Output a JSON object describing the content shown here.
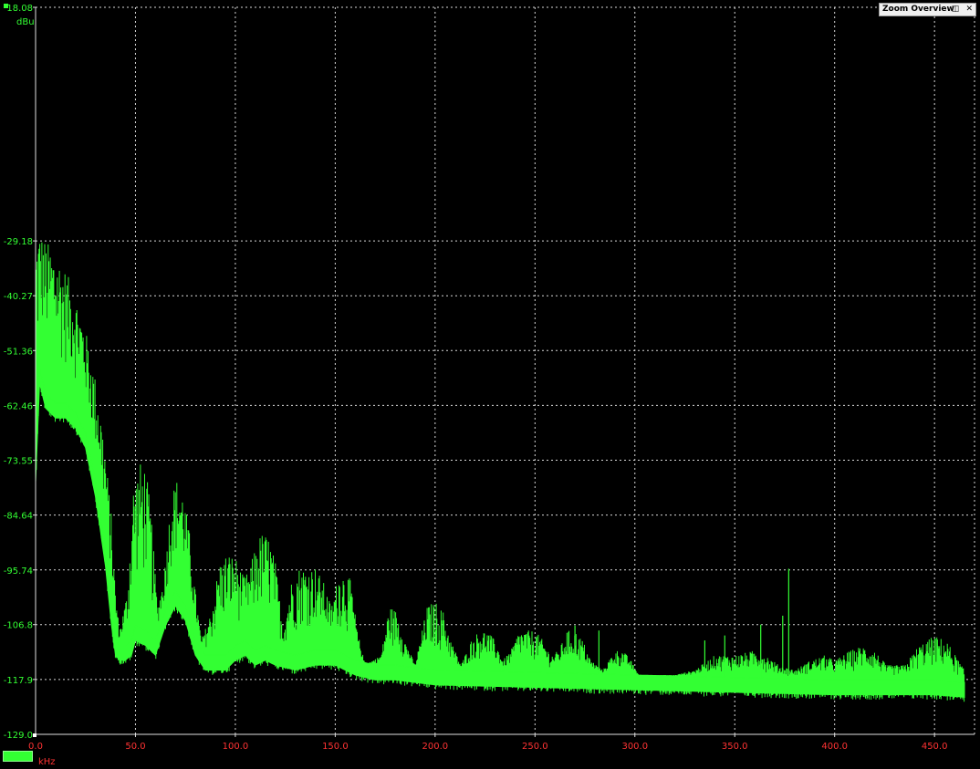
{
  "window": {
    "zoom_overview_label": "Zoom Overview",
    "zoom_overview_buttons": [
      "restore-icon",
      "close-icon"
    ]
  },
  "colors": {
    "trace": "#33ff33",
    "y_labels": "#33ff33",
    "x_labels": "#ff3333",
    "grid": "#d8d8d8",
    "background": "#000000"
  },
  "chart_data": {
    "type": "line",
    "title": "",
    "xlabel": "kHz",
    "ylabel": "dBu",
    "xlim": [
      0,
      465
    ],
    "ylim": [
      -129.0,
      18.08
    ],
    "grid": true,
    "y_tick_values": [
      18.08,
      -29.18,
      -40.27,
      -51.36,
      -62.46,
      -73.55,
      -84.64,
      -95.74,
      -106.8,
      -117.9,
      -129.0
    ],
    "y_tick_labels": [
      "18.08",
      "-29.18",
      "-40.27",
      "-51.36",
      "-62.46",
      "-73.55",
      "-84.64",
      "-95.74",
      "-106.8",
      "-117.9",
      "-129.0"
    ],
    "x_tick_values": [
      0,
      50,
      100,
      150,
      200,
      250,
      300,
      350,
      400,
      450
    ],
    "x_tick_labels": [
      "0.0",
      "50.0",
      "100.0",
      "150.0",
      "200.0",
      "250.0",
      "300.0",
      "350.0",
      "400.0",
      "450.0"
    ],
    "series": [
      {
        "color": "#33ff33",
        "noise_floor": [
          [
            0,
            -75
          ],
          [
            2,
            -55
          ],
          [
            5,
            -60
          ],
          [
            10,
            -62
          ],
          [
            15,
            -62
          ],
          [
            20,
            -64
          ],
          [
            25,
            -68
          ],
          [
            30,
            -78
          ],
          [
            35,
            -92
          ],
          [
            38,
            -104
          ],
          [
            40,
            -110
          ],
          [
            42,
            -111
          ],
          [
            45,
            -111
          ],
          [
            48,
            -110
          ],
          [
            50,
            -107
          ],
          [
            55,
            -108
          ],
          [
            60,
            -110
          ],
          [
            65,
            -104
          ],
          [
            70,
            -100
          ],
          [
            75,
            -103
          ],
          [
            80,
            -110
          ],
          [
            85,
            -113
          ],
          [
            90,
            -113
          ],
          [
            95,
            -113
          ],
          [
            100,
            -111
          ],
          [
            105,
            -110
          ],
          [
            110,
            -112
          ],
          [
            115,
            -111
          ],
          [
            120,
            -112
          ],
          [
            130,
            -113
          ],
          [
            140,
            -112
          ],
          [
            150,
            -112
          ],
          [
            160,
            -114
          ],
          [
            170,
            -115
          ],
          [
            180,
            -115
          ],
          [
            200,
            -116
          ],
          [
            250,
            -116.5
          ],
          [
            300,
            -117
          ],
          [
            350,
            -117.5
          ],
          [
            400,
            -118
          ],
          [
            450,
            -118
          ],
          [
            465,
            -118.5
          ]
        ],
        "envelope": [
          [
            0,
            -27
          ],
          [
            2,
            -27
          ],
          [
            5,
            -29
          ],
          [
            10,
            -31
          ],
          [
            15,
            -35
          ],
          [
            20,
            -40
          ],
          [
            25,
            -47
          ],
          [
            30,
            -57
          ],
          [
            33,
            -65
          ],
          [
            35,
            -72
          ],
          [
            38,
            -85
          ],
          [
            40,
            -100
          ],
          [
            42,
            -108
          ],
          [
            46,
            -100
          ],
          [
            49,
            -78
          ],
          [
            52,
            -74
          ],
          [
            55,
            -74
          ],
          [
            58,
            -85
          ],
          [
            61,
            -103
          ],
          [
            64,
            -98
          ],
          [
            68,
            -80
          ],
          [
            71,
            -77
          ],
          [
            74,
            -80
          ],
          [
            77,
            -88
          ],
          [
            80,
            -100
          ],
          [
            83,
            -110
          ],
          [
            88,
            -104
          ],
          [
            92,
            -94
          ],
          [
            96,
            -92
          ],
          [
            100,
            -93
          ],
          [
            104,
            -97
          ],
          [
            107,
            -96
          ],
          [
            111,
            -89
          ],
          [
            114,
            -88
          ],
          [
            117,
            -89
          ],
          [
            120,
            -94
          ],
          [
            124,
            -108
          ],
          [
            128,
            -98
          ],
          [
            132,
            -95
          ],
          [
            136,
            -95
          ],
          [
            140,
            -95
          ],
          [
            144,
            -98
          ],
          [
            148,
            -103
          ],
          [
            152,
            -96
          ],
          [
            155,
            -96
          ],
          [
            158,
            -98
          ],
          [
            161,
            -108
          ],
          [
            165,
            -115
          ],
          [
            173,
            -113
          ],
          [
            177,
            -103
          ],
          [
            181,
            -104
          ],
          [
            185,
            -110
          ],
          [
            190,
            -115
          ],
          [
            196,
            -103
          ],
          [
            200,
            -102
          ],
          [
            204,
            -104
          ],
          [
            208,
            -110
          ],
          [
            213,
            -115
          ],
          [
            218,
            -110
          ],
          [
            222,
            -108
          ],
          [
            226,
            -108
          ],
          [
            230,
            -110
          ],
          [
            234,
            -114
          ],
          [
            238,
            -112
          ],
          [
            242,
            -108
          ],
          [
            246,
            -108
          ],
          [
            250,
            -108
          ],
          [
            254,
            -110
          ],
          [
            258,
            -113
          ],
          [
            262,
            -112
          ],
          [
            266,
            -108
          ],
          [
            270,
            -108
          ],
          [
            274,
            -110
          ],
          [
            278,
            -114
          ],
          [
            284,
            -116
          ],
          [
            290,
            -112
          ],
          [
            294,
            -112
          ],
          [
            298,
            -114
          ],
          [
            302,
            -117
          ],
          [
            320,
            -117
          ],
          [
            330,
            -116
          ],
          [
            340,
            -113
          ],
          [
            350,
            -113
          ],
          [
            360,
            -112
          ],
          [
            366,
            -113
          ],
          [
            372,
            -115
          ],
          [
            380,
            -116
          ],
          [
            388,
            -114
          ],
          [
            395,
            -113
          ],
          [
            400,
            -114
          ],
          [
            408,
            -112
          ],
          [
            414,
            -111
          ],
          [
            420,
            -112
          ],
          [
            426,
            -115
          ],
          [
            435,
            -115
          ],
          [
            442,
            -111
          ],
          [
            450,
            -109
          ],
          [
            456,
            -110
          ],
          [
            462,
            -114
          ],
          [
            465,
            -116
          ]
        ],
        "spurs": [
          [
            377,
            -95.5
          ],
          [
            374,
            -105
          ],
          [
            363,
            -106.8
          ],
          [
            345,
            -109
          ],
          [
            335,
            -110
          ],
          [
            270,
            -107
          ],
          [
            282,
            -108
          ]
        ]
      }
    ]
  }
}
